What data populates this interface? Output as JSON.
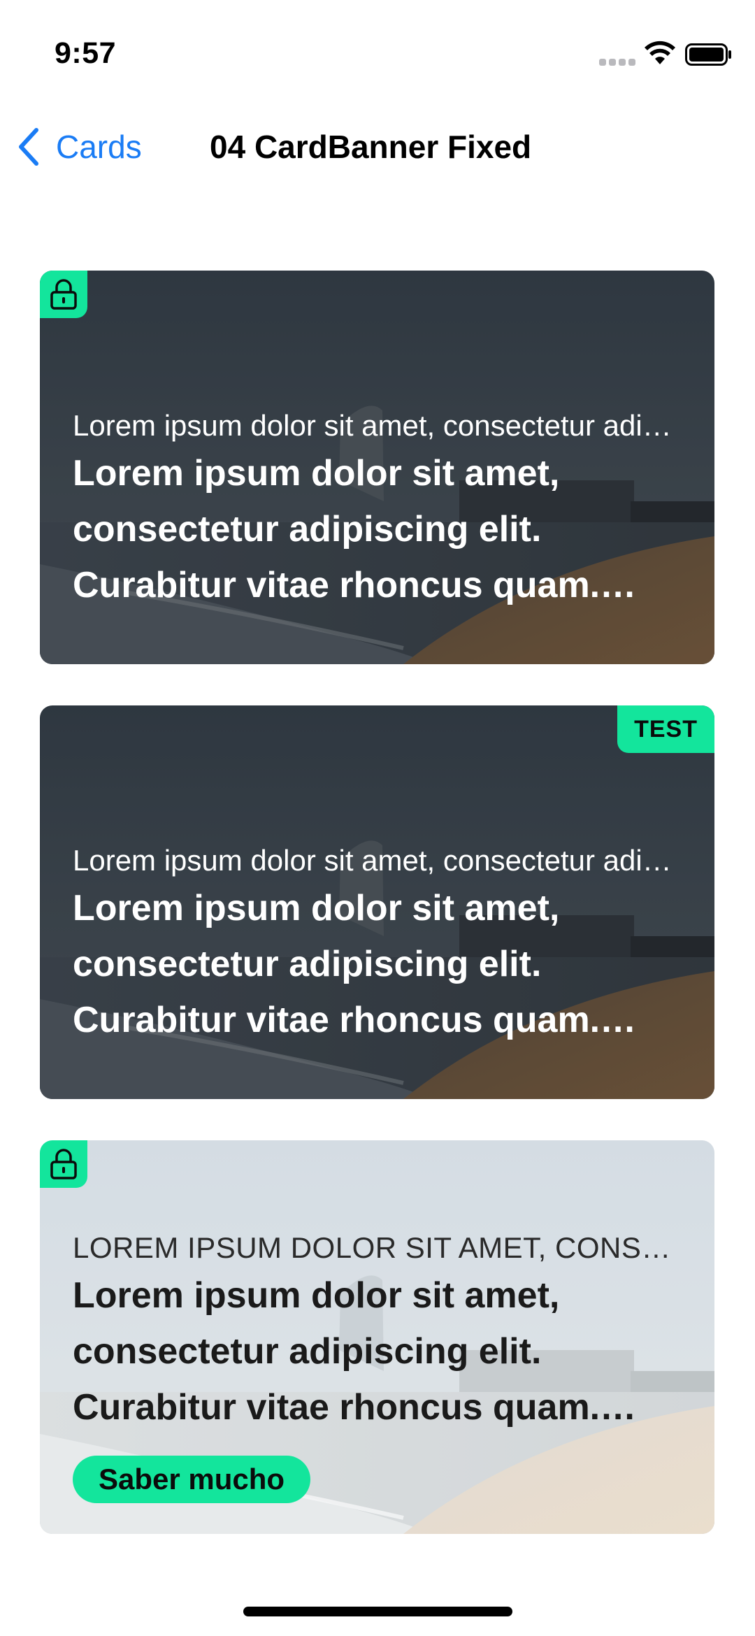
{
  "status_bar": {
    "time": "9:57"
  },
  "nav": {
    "back_label": "Cards",
    "title": "04 CardBanner Fixed"
  },
  "cards": [
    {
      "theme": "dark",
      "badge": {
        "type": "lock",
        "icon": "lock-icon"
      },
      "subtitle": "Lorem ipsum dolor sit amet, consectetur adipiscing elit.",
      "title": "Lorem ipsum dolor sit amet, consectetur adipiscing elit. Curabitur vitae rhoncus quam. Donec ut nisi eget elit"
    },
    {
      "theme": "dark",
      "badge": {
        "type": "tag",
        "label": "TEST"
      },
      "subtitle": "Lorem ipsum dolor sit amet, consectetur adipiscing elit.",
      "title": "Lorem ipsum dolor sit amet, consectetur adipiscing elit. Curabitur vitae rhoncus quam. Donec ut nisi eget elit"
    },
    {
      "theme": "light",
      "badge": {
        "type": "lock",
        "icon": "lock-icon"
      },
      "subtitle": "LOREM IPSUM DOLOR SIT AMET, CONSECTETUR ADIPISCING ELIT.",
      "title": "Lorem ipsum dolor sit amet, consectetur adipiscing elit. Curabitur vitae rhoncus quam. Donec ut nisi eget elit",
      "cta_label": "Saber mucho"
    }
  ],
  "colors": {
    "accent": "#13e59c",
    "link": "#1a7cf5"
  }
}
